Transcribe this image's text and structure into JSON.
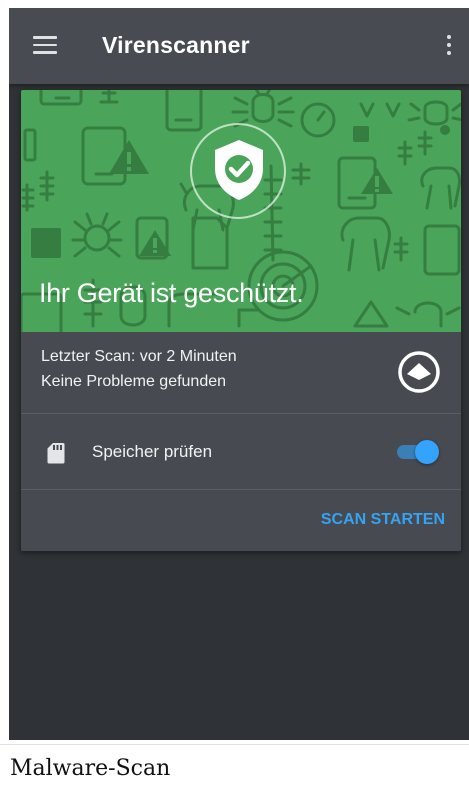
{
  "app_bar": {
    "title": "Virenscanner",
    "menu_icon": "hamburger-menu-icon",
    "overflow_icon": "more-vert-icon",
    "background": "#484c52"
  },
  "status_card": {
    "headline": "Ihr Gerät ist geschützt.",
    "shield_icon": "shield-check-icon",
    "hero_color": "#4aa55a",
    "last_scan": "Letzter Scan: vor 2 Minuten",
    "problems": "Keine Probleme gefunden",
    "status_icon": "clean-scan-icon",
    "storage_label": "Speicher prüfen",
    "storage_icon": "sd-card-icon",
    "storage_toggle_on": true,
    "scan_button_label": "SCAN STARTEN",
    "accent_color": "#35a3f2"
  },
  "caption": "Malware-Scan"
}
